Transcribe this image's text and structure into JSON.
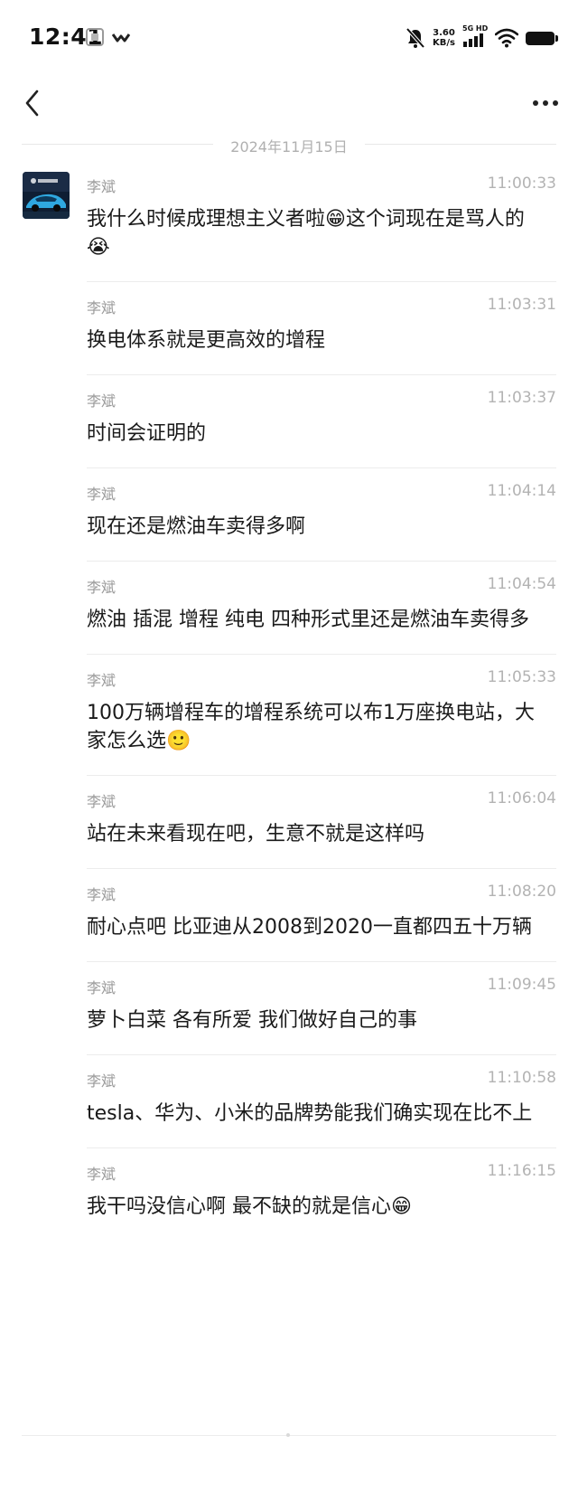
{
  "status_bar": {
    "time": "12:41",
    "net_speed_value": "3.60",
    "net_speed_unit": "KB/s",
    "network_label": "5G HD"
  },
  "nav": {
    "back_icon": "chevron-left-icon",
    "more_icon": "more-horizontal-icon"
  },
  "date_divider": "2024年11月15日",
  "messages": [
    {
      "sender": "李斌",
      "time": "11:00:33",
      "text": "我什么时候成理想主义者啦😁这个词现在是骂人的😭"
    },
    {
      "sender": "李斌",
      "time": "11:03:31",
      "text": "换电体系就是更高效的增程"
    },
    {
      "sender": "李斌",
      "time": "11:03:37",
      "text": "时间会证明的"
    },
    {
      "sender": "李斌",
      "time": "11:04:14",
      "text": "现在还是燃油车卖得多啊"
    },
    {
      "sender": "李斌",
      "time": "11:04:54",
      "text": "燃油 插混 增程 纯电 四种形式里还是燃油车卖得多"
    },
    {
      "sender": "李斌",
      "time": "11:05:33",
      "text": "100万辆增程车的增程系统可以布1万座换电站，大家怎么选🙂"
    },
    {
      "sender": "李斌",
      "time": "11:06:04",
      "text": "站在未来看现在吧，生意不就是这样吗"
    },
    {
      "sender": "李斌",
      "time": "11:08:20",
      "text": "耐心点吧 比亚迪从2008到2020一直都四五十万辆"
    },
    {
      "sender": "李斌",
      "time": "11:09:45",
      "text": "萝卜白菜 各有所爱 我们做好自己的事"
    },
    {
      "sender": "李斌",
      "time": "11:10:58",
      "text": "tesla、华为、小米的品牌势能我们确实现在比不上"
    },
    {
      "sender": "李斌",
      "time": "11:16:15",
      "text": "我干吗没信心啊 最不缺的就是信心😁"
    }
  ],
  "colors": {
    "text_primary": "#1a1a1a",
    "text_secondary": "#9a9a9a",
    "timestamp": "#b3b3b3",
    "divider": "#ececec",
    "avatar_bg": "#0f1e33",
    "avatar_car": "#2fa8e0"
  }
}
